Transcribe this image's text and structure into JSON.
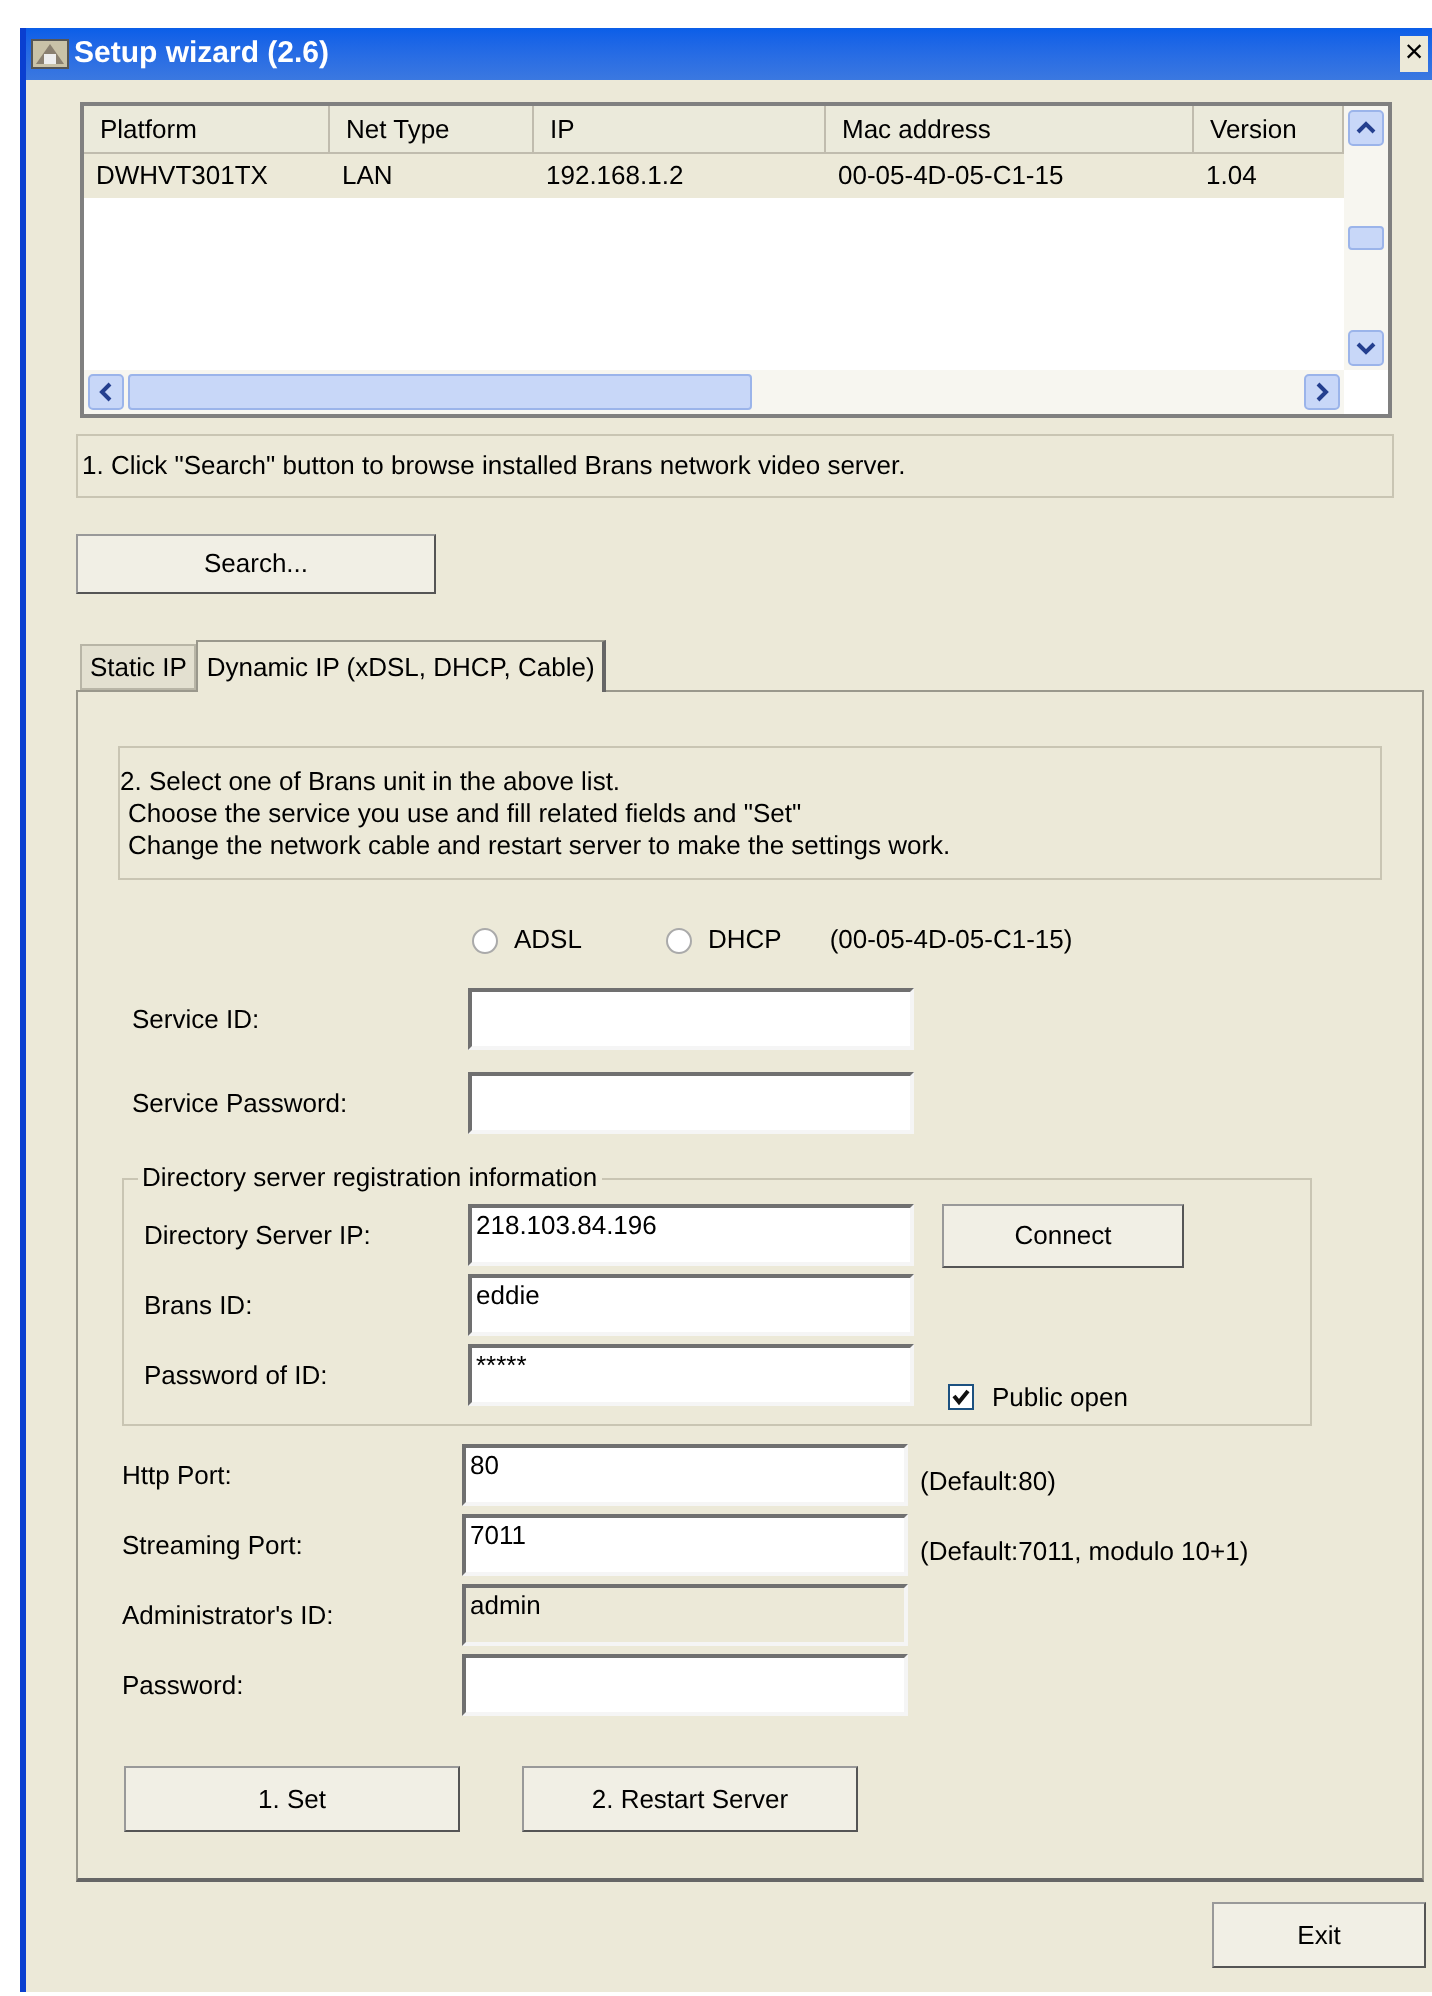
{
  "window": {
    "title": "Setup wizard (2.6)",
    "close": "×"
  },
  "device_list": {
    "columns": [
      "Platform",
      "Net Type",
      "IP",
      "Mac address",
      "Version"
    ],
    "rows": [
      {
        "selected": true,
        "cells": [
          "DWHVT301TX",
          "LAN",
          "192.168.1.2",
          "00-05-4D-05-C1-15",
          "1.04"
        ]
      }
    ]
  },
  "status_message": "1. Click \"Search\" button to browse installed Brans network video server.",
  "search_button": "Search...",
  "tabs": [
    {
      "label": "Static IP",
      "selected": false
    },
    {
      "label": "Dynamic IP (xDSL, DHCP, Cable)",
      "selected": true
    }
  ],
  "instructions": [
    "2. Select one of Brans unit in the above list.",
    "Choose the service you use and fill related fields and \"Set\"",
    "Change the network cable and restart server to make the settings work."
  ],
  "connection_types": [
    {
      "label": "ADSL",
      "selected": false
    },
    {
      "label": "DHCP",
      "selected": false
    }
  ],
  "mac_label": "(00-05-4D-05-C1-15)",
  "service_fields": [
    {
      "label": "Service ID:"
    },
    {
      "label": "Service Password:"
    }
  ],
  "directory_group": {
    "legend": "Directory server registration information",
    "fields": [
      {
        "label": "Directory Server IP:",
        "value": "218.103.84.196"
      },
      {
        "label": "Brans ID:",
        "value": "eddie"
      },
      {
        "label": "Password of ID:",
        "value": "*****"
      }
    ],
    "connect_button": "Connect",
    "public_open": {
      "label": "Public open",
      "checked": true
    }
  },
  "port_fields": [
    {
      "label": "Http Port:",
      "value": "80",
      "hint": "(Default:80)",
      "disabled": false
    },
    {
      "label": "Streaming Port:",
      "value": "7011",
      "hint": "(Default:7011, modulo 10+1)",
      "disabled": false
    },
    {
      "label": "Administrator's ID:",
      "value": "admin",
      "disabled": true
    },
    {
      "label": "Password:",
      "disabled": false
    }
  ],
  "action_buttons": [
    "1. Set",
    "2. Restart Server"
  ],
  "exit_button": "Exit"
}
